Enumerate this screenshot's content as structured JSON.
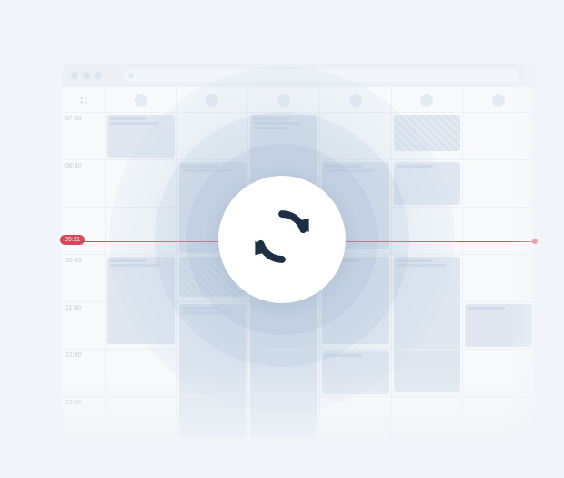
{
  "calendar": {
    "time_labels": [
      "07:00",
      "08:00",
      "",
      "10:00",
      "11:00",
      "12:00",
      "13:00"
    ],
    "now_time": "09:11",
    "columns": 6
  },
  "icon": {
    "center": "sync-icon"
  }
}
